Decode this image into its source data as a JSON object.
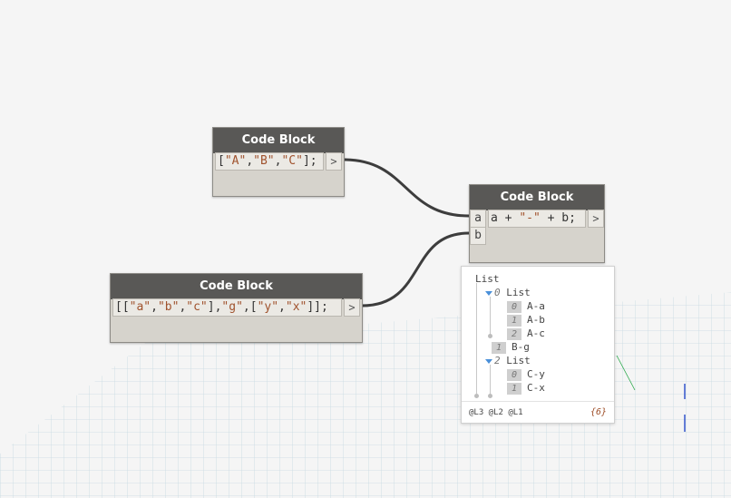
{
  "nodes": {
    "node1": {
      "title": "Code Block",
      "code": [
        [
          "[",
          ""
        ],
        [
          "\"A\"",
          "str"
        ],
        [
          ",",
          ""
        ],
        [
          "\"B\"",
          "str"
        ],
        [
          ",",
          ""
        ],
        [
          "\"C\"",
          "str"
        ],
        [
          "];",
          ""
        ]
      ],
      "output_port": ">"
    },
    "node2": {
      "title": "Code Block",
      "code": [
        [
          "[[",
          ""
        ],
        [
          "\"a\"",
          "str"
        ],
        [
          ",",
          ""
        ],
        [
          "\"b\"",
          "str"
        ],
        [
          ",",
          ""
        ],
        [
          "\"c\"",
          "str"
        ],
        [
          "],",
          ""
        ],
        [
          "\"g\"",
          "str"
        ],
        [
          ",[",
          ""
        ],
        [
          "\"y\"",
          "str"
        ],
        [
          ",",
          ""
        ],
        [
          "\"x\"",
          "str"
        ],
        [
          "]];",
          ""
        ]
      ],
      "output_port": ">"
    },
    "node3": {
      "title": "Code Block",
      "code": [
        [
          "a + ",
          ""
        ],
        [
          "\"-\"",
          "str"
        ],
        [
          " + b;",
          ""
        ]
      ],
      "input_ports": [
        "a",
        "b"
      ],
      "output_port": ">"
    }
  },
  "preview": {
    "root_label": "List",
    "items": [
      {
        "kind": "list",
        "index": "0",
        "label": "List",
        "depth": 1
      },
      {
        "kind": "leaf",
        "index": "0",
        "label": "A-a",
        "depth": 2
      },
      {
        "kind": "leaf",
        "index": "1",
        "label": "A-b",
        "depth": 2
      },
      {
        "kind": "leaf",
        "index": "2",
        "label": "A-c",
        "depth": 2
      },
      {
        "kind": "leaf",
        "index": "1",
        "label": "B-g",
        "depth": 1
      },
      {
        "kind": "list",
        "index": "2",
        "label": "List",
        "depth": 1
      },
      {
        "kind": "leaf",
        "index": "0",
        "label": "C-y",
        "depth": 2
      },
      {
        "kind": "leaf",
        "index": "1",
        "label": "C-x",
        "depth": 2
      }
    ],
    "levels": "@L3 @L2 @L1",
    "count": "{6}"
  },
  "colors": {
    "header": "#595856",
    "node_body": "#d6d3cc",
    "string": "#a0522d",
    "wire": "#3d3d3d",
    "grid": "#b9d2dc"
  }
}
